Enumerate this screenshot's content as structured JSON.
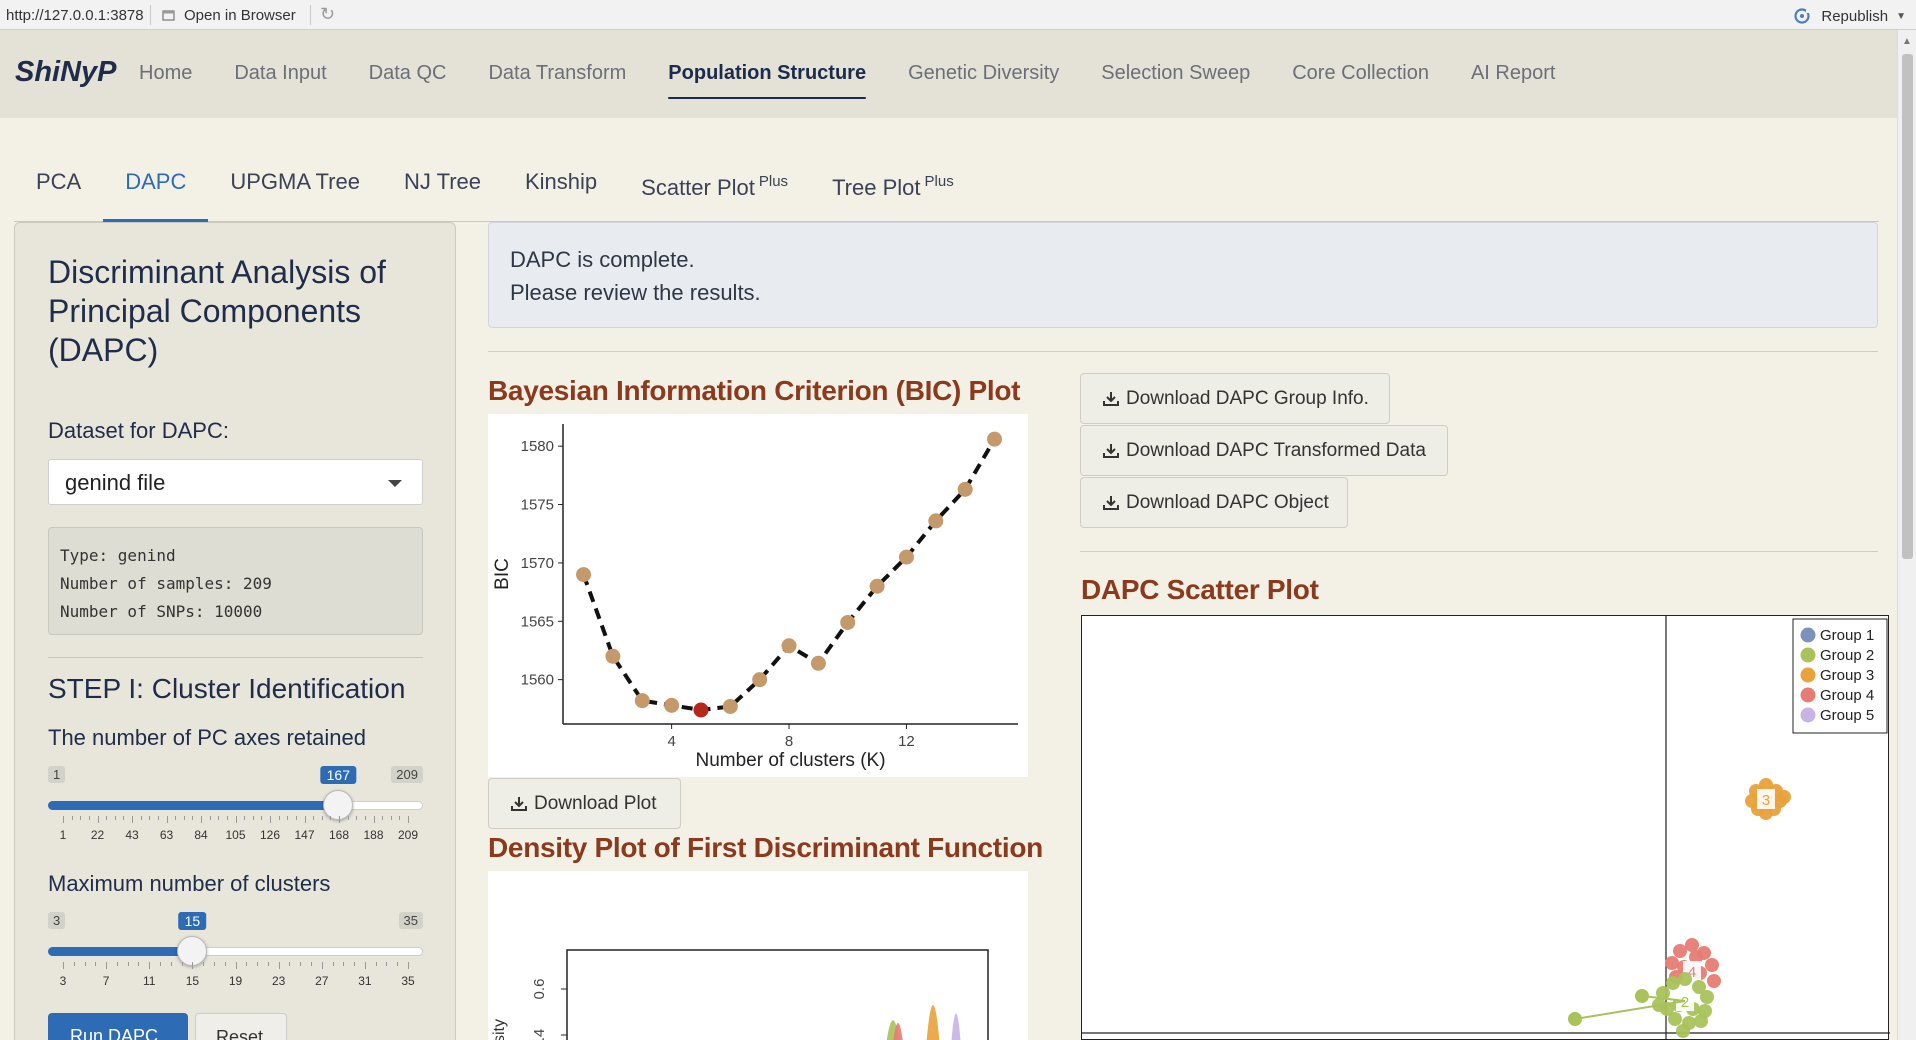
{
  "browser": {
    "url": "http://127.0.0.1:3878",
    "open_label": "Open in Browser",
    "republish_label": "Republish"
  },
  "navbar": {
    "brand": "ShiNyP",
    "items": [
      {
        "label": "Home"
      },
      {
        "label": "Data Input"
      },
      {
        "label": "Data QC"
      },
      {
        "label": "Data Transform"
      },
      {
        "label": "Population Structure",
        "active": true
      },
      {
        "label": "Genetic Diversity"
      },
      {
        "label": "Selection Sweep"
      },
      {
        "label": "Core Collection"
      },
      {
        "label": "AI Report"
      }
    ]
  },
  "subtabs": {
    "items": [
      {
        "label": "PCA"
      },
      {
        "label": "DAPC",
        "active": true
      },
      {
        "label": "UPGMA Tree"
      },
      {
        "label": "NJ Tree"
      },
      {
        "label": "Kinship"
      },
      {
        "label": "Scatter Plot",
        "sup": "Plus"
      },
      {
        "label": "Tree Plot",
        "sup": "Plus"
      }
    ]
  },
  "sidebar": {
    "title": "Discriminant Analysis of Principal Components (DAPC)",
    "dataset_label": "Dataset for DAPC:",
    "dataset_value": "genind file",
    "info_lines": [
      "Type: genind",
      "Number of samples: 209",
      "Number of SNPs: 10000"
    ],
    "step_title": "STEP I: Cluster Identification",
    "pc_slider": {
      "label": "The number of PC axes retained",
      "min": 1,
      "max": 209,
      "value": 167,
      "min_label": "1",
      "max_label": "209",
      "value_label": "167",
      "tick_labels": [
        "1",
        "22",
        "43",
        "63",
        "84",
        "105",
        "126",
        "147",
        "168",
        "188",
        "209"
      ]
    },
    "k_slider": {
      "label": "Maximum number of clusters",
      "min": 3,
      "max": 35,
      "value": 15,
      "min_label": "3",
      "max_label": "35",
      "value_label": "15",
      "tick_labels": [
        "3",
        "7",
        "11",
        "15",
        "19",
        "23",
        "27",
        "31",
        "35"
      ]
    },
    "run_button": "Run DAPC I",
    "reset_button": "Reset"
  },
  "main": {
    "alert_line1": "DAPC is complete.",
    "alert_line2": "Please review the results.",
    "bic_title": "Bayesian Information Criterion (BIC) Plot",
    "download_plot": "Download Plot",
    "density_title": "Density Plot of First Discriminant Function",
    "dl_group_info": "Download DAPC Group Info.",
    "dl_transformed": "Download DAPC Transformed Data",
    "dl_object": "Download DAPC Object",
    "scatter_title": "DAPC Scatter Plot"
  },
  "colors": {
    "accent": "#2e6bb5",
    "section_title": "#8b3a1d",
    "bic_point": "#c49a6c",
    "bic_selected": "#b5291c",
    "group1": "#7b93b8",
    "group2": "#a9c25a",
    "group3": "#e9a13b",
    "group4": "#e67c73",
    "group5": "#c7b3e6"
  },
  "chart_data": [
    {
      "type": "line",
      "xlabel": "Number of clusters (K)",
      "ylabel": "BIC",
      "x": [
        1,
        2,
        3,
        4,
        5,
        6,
        7,
        8,
        9,
        10,
        11,
        12,
        13,
        14,
        15
      ],
      "values": [
        1569.0,
        1562.0,
        1558.2,
        1557.8,
        1557.4,
        1557.7,
        1560.0,
        1562.9,
        1561.4,
        1564.9,
        1568.0,
        1570.5,
        1573.6,
        1576.3,
        1580.6
      ],
      "selected_x": 5,
      "xlim": [
        0.3,
        15.8
      ],
      "ylim": [
        1556.2,
        1581.9
      ],
      "xticks": [
        "4",
        "8",
        "12"
      ],
      "yticks": [
        "1560",
        "1565",
        "1570",
        "1575",
        "1580"
      ],
      "grid": false
    },
    {
      "type": "area",
      "ylabel": "sity",
      "yticks": [
        "0.6",
        ".4"
      ],
      "series": [
        {
          "color": "#e9a13b",
          "peak_y": 0.74
        },
        {
          "color": "#c7b3e6",
          "peak_y": 0.62
        },
        {
          "color": "#a9c25a",
          "peak_y": 0.52
        },
        {
          "color": "#e67c73",
          "peak_y": 0.48
        }
      ]
    },
    {
      "type": "scatter",
      "legend": [
        "Group 1",
        "Group 2",
        "Group 3",
        "Group 4",
        "Group 5"
      ],
      "legend_position": "top-right",
      "clusters": [
        {
          "group": "Group 3",
          "label": "3",
          "color": "#e9a13b"
        },
        {
          "group": "Group 4",
          "label": "4",
          "color": "#e67c73"
        },
        {
          "group": "Group 2",
          "label": "2",
          "color": "#a9c25a"
        }
      ]
    }
  ]
}
